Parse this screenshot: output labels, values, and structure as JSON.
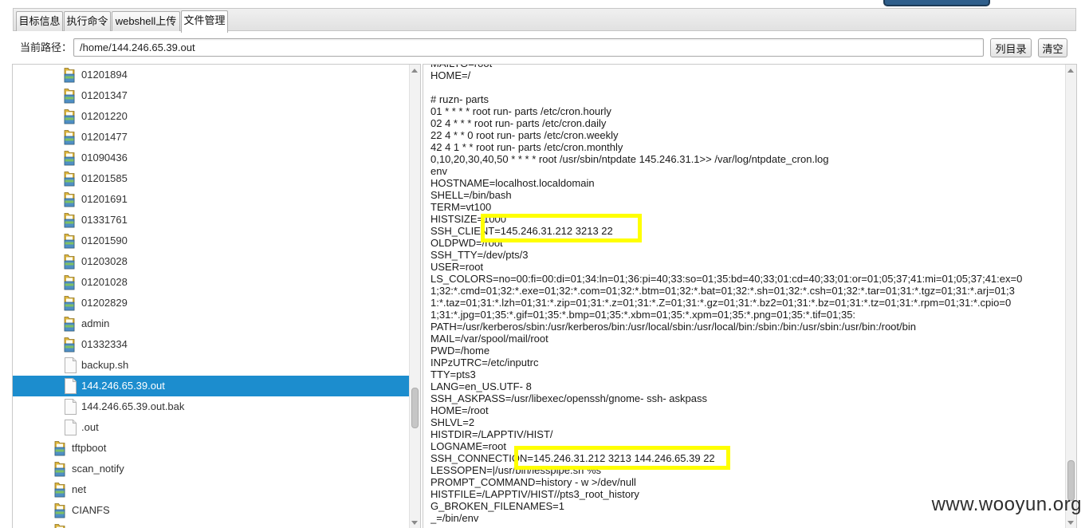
{
  "tabs": [
    {
      "label": "目标信息",
      "active": false
    },
    {
      "label": "执行命令",
      "active": false
    },
    {
      "label": "webshell上传",
      "active": false
    },
    {
      "label": "文件管理",
      "active": true
    }
  ],
  "path_bar": {
    "label": "当前路径：",
    "value": "/home/144.246.65.39.out",
    "list_button": "列目录",
    "clear_button": "清空"
  },
  "file_tree": {
    "selected": "144.246.65.39.out",
    "items": [
      {
        "label": "01201894",
        "icon": "folder-icon",
        "level": 2
      },
      {
        "label": "01201347",
        "icon": "folder-icon",
        "level": 2
      },
      {
        "label": "01201220",
        "icon": "folder-icon",
        "level": 2
      },
      {
        "label": "01201477",
        "icon": "folder-icon",
        "level": 2
      },
      {
        "label": "01090436",
        "icon": "folder-icon",
        "level": 2
      },
      {
        "label": "01201585",
        "icon": "folder-icon",
        "level": 2
      },
      {
        "label": "01201691",
        "icon": "folder-icon",
        "level": 2
      },
      {
        "label": "01331761",
        "icon": "folder-icon",
        "level": 2
      },
      {
        "label": "01201590",
        "icon": "folder-icon",
        "level": 2
      },
      {
        "label": "01203028",
        "icon": "folder-icon",
        "level": 2
      },
      {
        "label": "01201028",
        "icon": "folder-icon",
        "level": 2
      },
      {
        "label": "01202829",
        "icon": "folder-icon",
        "level": 2
      },
      {
        "label": "admin",
        "icon": "folder-icon",
        "level": 2
      },
      {
        "label": "01332334",
        "icon": "folder-icon",
        "level": 2
      },
      {
        "label": "backup.sh",
        "icon": "file-icon",
        "level": 2
      },
      {
        "label": "144.246.65.39.out",
        "icon": "file-icon",
        "level": 2
      },
      {
        "label": "144.246.65.39.out.bak",
        "icon": "file-icon",
        "level": 2
      },
      {
        "label": ".out",
        "icon": "file-icon",
        "level": 2
      },
      {
        "label": "tftpboot",
        "icon": "folder-icon",
        "level": 1
      },
      {
        "label": "scan_notify",
        "icon": "folder-icon",
        "level": 1
      },
      {
        "label": "net",
        "icon": "folder-icon",
        "level": 1
      },
      {
        "label": "CIANFS",
        "icon": "folder-icon",
        "level": 1
      },
      {
        "label": "",
        "icon": "folder-icon",
        "level": 1
      }
    ]
  },
  "output": {
    "lines": [
      "MAILTO=root",
      "HOME=/",
      "",
      "# ruzn- parts",
      "01 * * * * root run- parts /etc/cron.hourly",
      "02 4 * * * root run- parts /etc/cron.daily",
      "22 4 * * 0 root run- parts /etc/cron.weekly",
      "42 4 1 * * root run- parts /etc/cron.monthly",
      "0,10,20,30,40,50 * * * * root /usr/sbin/ntpdate 145.246.31.1>> /var/log/ntpdate_cron.log",
      "env",
      "HOSTNAME=localhost.localdomain",
      "SHELL=/bin/bash",
      "TERM=vt100",
      "HISTSIZE=1000",
      "SSH_CLIENT=145.246.31.212 3213 22",
      "OLDPWD=/root",
      "SSH_TTY=/dev/pts/3",
      "USER=root",
      "LS_COLORS=no=00:fi=00:di=01;34:ln=01;36:pi=40;33:so=01;35:bd=40;33;01:cd=40;33;01:or=01;05;37;41:mi=01;05;37;41:ex=0",
      "1;32:*.cmd=01;32:*.exe=01;32:*.com=01;32:*.btm=01;32:*.bat=01;32:*.sh=01;32:*.csh=01;32:*.tar=01;31:*.tgz=01;31:*.arj=01;3",
      "1:*.taz=01;31:*.lzh=01;31:*.zip=01;31:*.z=01;31:*.Z=01;31:*.gz=01;31:*.bz2=01;31:*.bz=01;31:*.tz=01;31:*.rpm=01;31:*.cpio=0",
      "1;31:*.jpg=01;35:*.gif=01;35:*.bmp=01;35:*.xbm=01;35:*.xpm=01;35:*.png=01;35:*.tif=01;35:",
      "PATH=/usr/kerberos/sbin:/usr/kerberos/bin:/usr/local/sbin:/usr/local/bin:/sbin:/bin:/usr/sbin:/usr/bin:/root/bin",
      "MAIL=/var/spool/mail/root",
      "PWD=/home",
      "INPzUTRC=/etc/inputrc",
      "TTY=pts3",
      "LANG=en_US.UTF- 8",
      "SSH_ASKPASS=/usr/libexec/openssh/gnome- ssh- askpass",
      "HOME=/root",
      "SHLVL=2",
      "HISTDIR=/LAPPTIV/HIST/",
      "LOGNAME=root",
      "SSH_CONNECTION=145.246.31.212 3213 144.246.65.39 22",
      "LESSOPEN=|/usr/bin/lesspipe.sh %s",
      "PROMPT_COMMAND=history - w >/dev/null",
      "HISTFILE=/LAPPTIV/HIST//pts3_root_history",
      "G_BROKEN_FILENAMES=1",
      "_=/bin/env"
    ]
  },
  "colors": {
    "selection": "#1c8dce",
    "annotation": "#ffff00"
  },
  "watermark": "www.wooyun.org"
}
